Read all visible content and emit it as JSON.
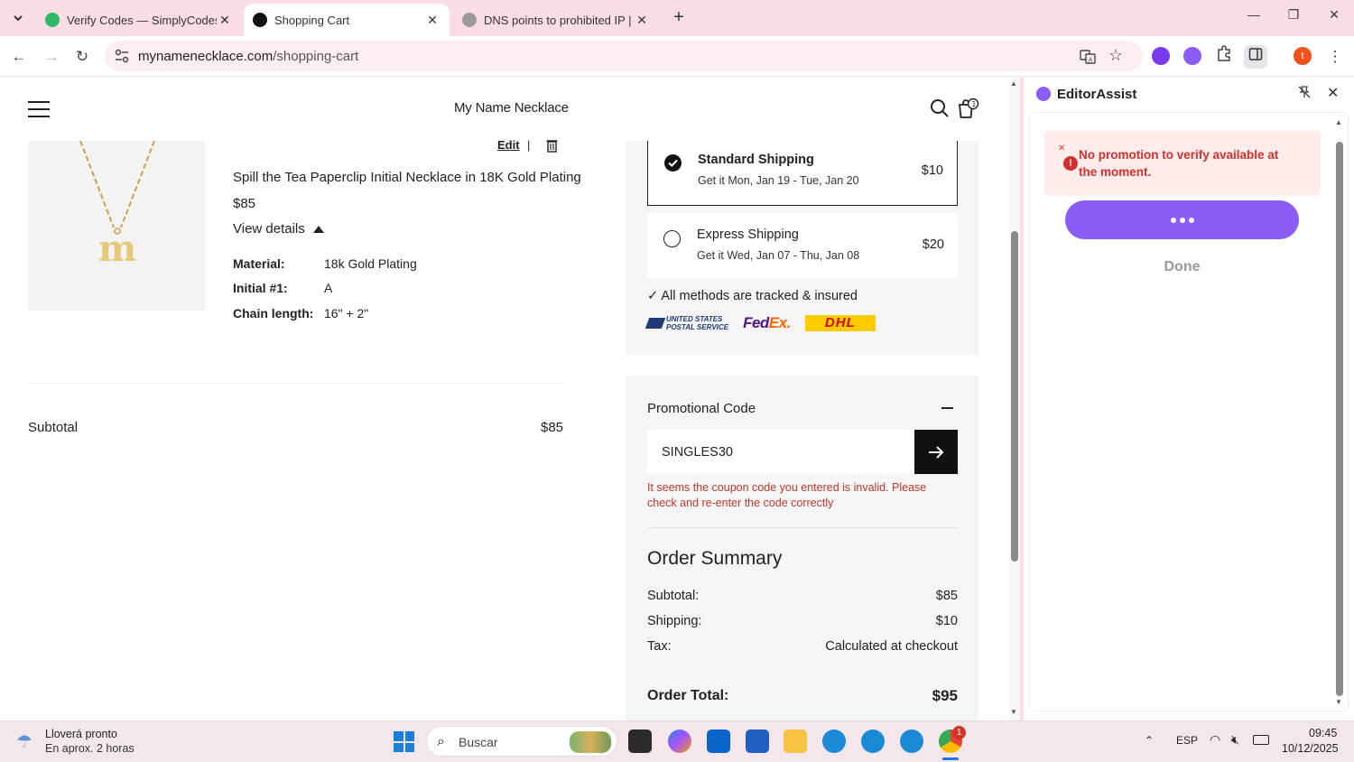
{
  "browser": {
    "tabs": [
      {
        "title": "Verify Codes — SimplyCodes",
        "active": false
      },
      {
        "title": "Shopping Cart",
        "active": true
      },
      {
        "title": "DNS points to prohibited IP | gi",
        "active": false
      }
    ],
    "new_tab": "+",
    "url_host": "mynamenecklace.com",
    "url_path": "/shopping-cart",
    "profile_initial": "t"
  },
  "site": {
    "brand": "My Name Necklace"
  },
  "cart_item": {
    "edit_label": "Edit",
    "separator": "|",
    "name": "Spill the Tea Paperclip Initial Necklace in 18K Gold Plating",
    "price": "$85",
    "view_details": "View details",
    "pendant_letter": "m",
    "specs": [
      {
        "label": "Material:",
        "value": "18k Gold Plating"
      },
      {
        "label": "Initial #1:",
        "value": "A"
      },
      {
        "label": "Chain length:",
        "value": "16\" + 2\""
      }
    ],
    "subtotal_label": "Subtotal",
    "subtotal_value": "$85"
  },
  "shipping": {
    "options": [
      {
        "name": "Standard Shipping",
        "date": "Get it Mon, Jan 19 - Tue, Jan 20",
        "price": "$10",
        "selected": true
      },
      {
        "name": "Express Shipping",
        "date": "Get it Wed, Jan 07 - Thu, Jan 08",
        "price": "$20",
        "selected": false
      }
    ],
    "tracked_note": "✓ All methods are tracked & insured",
    "carriers": {
      "usps_line1": "UNITED STATES",
      "usps_line2": "POSTAL SERVICE",
      "fedex_fed": "Fed",
      "fedex_ex": "Ex.",
      "dhl": "DHL"
    }
  },
  "promo": {
    "title": "Promotional Code",
    "code_value": "SINGLES30",
    "error": "It seems the coupon code you entered is invalid. Please check and re-enter the code correctly"
  },
  "summary": {
    "title": "Order Summary",
    "rows": [
      {
        "label": "Subtotal:",
        "value": "$85"
      },
      {
        "label": "Shipping:",
        "value": "$10"
      },
      {
        "label": "Tax:",
        "value": "Calculated at checkout"
      }
    ],
    "total_label": "Order Total:",
    "total_value": "$95"
  },
  "side_panel": {
    "title": "EditorAssist",
    "toast_message": "No promotion to verify available at the moment.",
    "done_label": "Done"
  },
  "taskbar": {
    "weather_title": "Lloverá pronto",
    "weather_sub": "En aprox. 2 horas",
    "search_label": "Buscar",
    "language": "ESP",
    "time": "09:45",
    "date": "10/12/2025",
    "chrome_badge": "1"
  },
  "colors": {
    "accent_purple": "#8b5cf6",
    "error_red": "#d32f2f",
    "tab_strip_pink": "#fbdde4"
  }
}
